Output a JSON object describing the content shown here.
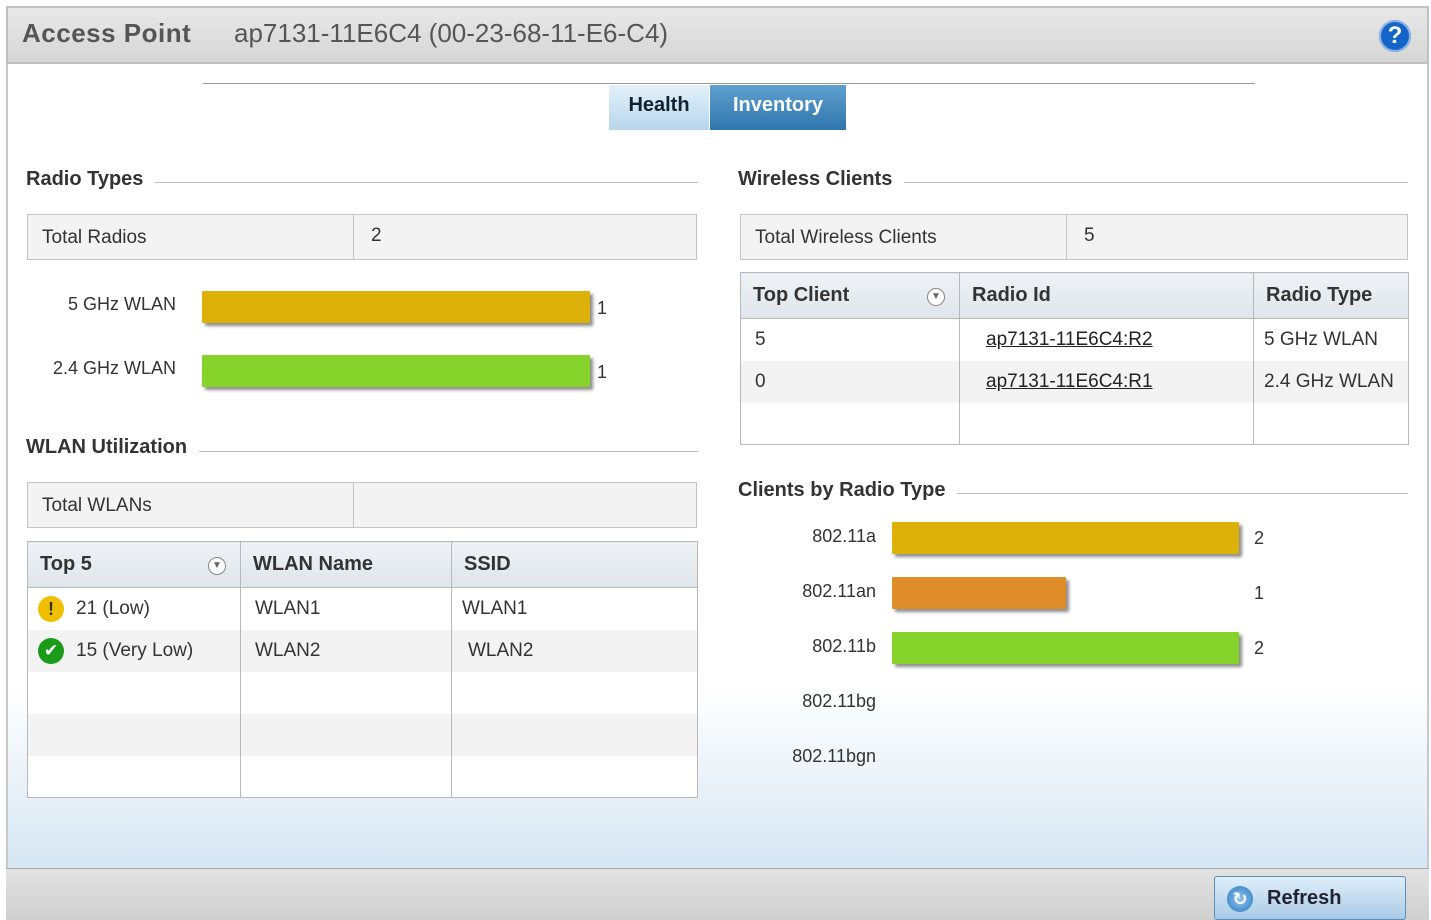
{
  "header": {
    "title": "Access Point",
    "device": "ap7131-11E6C4 (00-23-68-11-E6-C4)",
    "help_icon": "?"
  },
  "tabs": [
    {
      "label": "Health",
      "active": false
    },
    {
      "label": "Inventory",
      "active": true
    }
  ],
  "radio_types": {
    "title": "Radio Types",
    "total_label": "Total Radios",
    "total_value": "2",
    "bars": [
      {
        "label": "5 GHz WLAN",
        "value": 1,
        "value_text": "1",
        "color": "#dbb10a"
      },
      {
        "label": "2.4 GHz WLAN",
        "value": 1,
        "value_text": "1",
        "color": "#86d42b"
      }
    ]
  },
  "wlan_utilization": {
    "title": "WLAN Utilization",
    "total_label": "Total WLANs",
    "total_value": "",
    "columns": [
      "Top 5",
      "WLAN Name",
      "SSID"
    ],
    "rows": [
      {
        "status": "warning",
        "status_icon": "!",
        "util": "21 (Low)",
        "name": "WLAN1",
        "ssid": "WLAN1"
      },
      {
        "status": "ok",
        "status_icon": "✔",
        "util": "15 (Very Low)",
        "name": "WLAN2",
        "ssid": "WLAN2"
      }
    ]
  },
  "wireless_clients": {
    "title": "Wireless Clients",
    "total_label": "Total Wireless Clients",
    "total_value": "5",
    "columns": [
      "Top Client",
      "Radio Id",
      "Radio Type"
    ],
    "rows": [
      {
        "client": "5",
        "radio_id": "ap7131-11E6C4:R2",
        "radio_type": "5 GHz WLAN"
      },
      {
        "client": "0",
        "radio_id": "ap7131-11E6C4:R1",
        "radio_type": "2.4 GHz WLAN"
      }
    ]
  },
  "clients_by_radio_type": {
    "title": "Clients by Radio Type",
    "bars": [
      {
        "label": "802.11a",
        "value": 2,
        "value_text": "2",
        "color": "#dbb10a"
      },
      {
        "label": "802.11an",
        "value": 1,
        "value_text": "1",
        "color": "#de8d28"
      },
      {
        "label": "802.11b",
        "value": 2,
        "value_text": "2",
        "color": "#86d42b"
      },
      {
        "label": "802.11bg",
        "value": 0,
        "value_text": "",
        "color": "#cccccc"
      },
      {
        "label": "802.11bgn",
        "value": 0,
        "value_text": "",
        "color": "#cccccc"
      }
    ]
  },
  "footer": {
    "refresh_label": "Refresh"
  }
}
